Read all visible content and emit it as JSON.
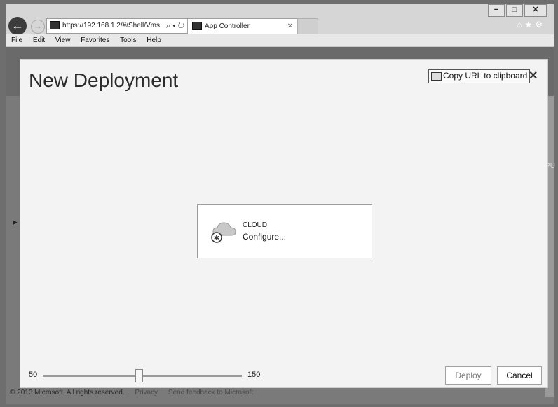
{
  "browser": {
    "url": "https://192.168.1.2/#/Shell/Vms",
    "tab_title": "App Controller",
    "win_min": "−",
    "win_max": "□",
    "win_close": "✕"
  },
  "menu": [
    "File",
    "Edit",
    "View",
    "Favorites",
    "Tools",
    "Help"
  ],
  "dialog": {
    "title": "New Deployment",
    "copy_url": "Copy URL to clipboard",
    "card_label": "CLOUD",
    "card_action": "Configure...",
    "slider": {
      "min": "50",
      "max": "150",
      "value_fraction": 0.48
    },
    "deploy": "Deploy",
    "cancel": "Cancel"
  },
  "background": {
    "truncated_text": "PU"
  },
  "footer": {
    "copyright": "© 2013 Microsoft. All rights reserved.",
    "privacy": "Privacy",
    "feedback": "Send feedback to Microsoft"
  }
}
